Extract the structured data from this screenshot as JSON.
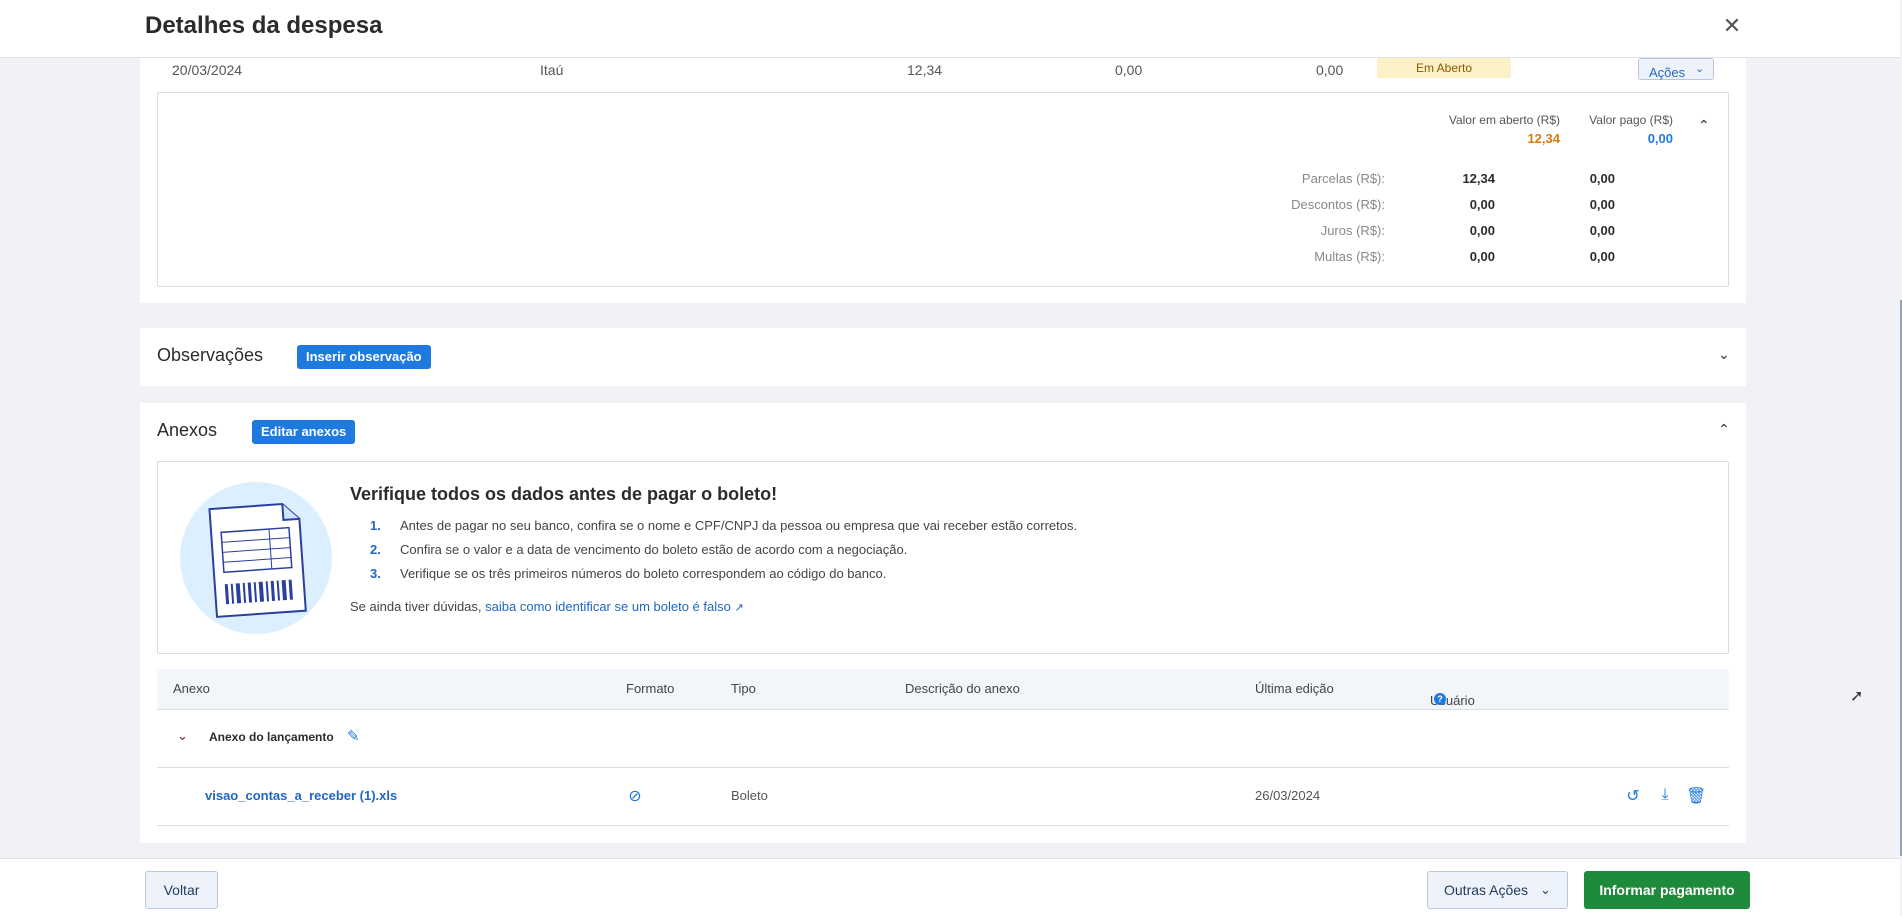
{
  "header": {
    "title": "Detalhes da despesa",
    "close_icon": "close-icon"
  },
  "installment": {
    "date": "20/03/2024",
    "bank": "Itaú",
    "value": "12,34",
    "v2": "0,00",
    "v3": "0,00",
    "status": "Em Aberto",
    "actions_label": "Ações"
  },
  "summary": {
    "open_label": "Valor em aberto (R$)",
    "paid_label": "Valor pago (R$)",
    "open_value": "12,34",
    "paid_value": "0,00",
    "open_color": "#d97a0f",
    "paid_color": "#1f7ae0",
    "rows": [
      {
        "label": "Parcelas (R$):",
        "open": "12,34",
        "paid": "0,00"
      },
      {
        "label": "Descontos (R$):",
        "open": "0,00",
        "paid": "0,00"
      },
      {
        "label": "Juros (R$):",
        "open": "0,00",
        "paid": "0,00"
      },
      {
        "label": "Multas (R$):",
        "open": "0,00",
        "paid": "0,00"
      }
    ]
  },
  "observations": {
    "title": "Observações",
    "button": "Inserir observação"
  },
  "attachments": {
    "title": "Anexos",
    "button": "Editar anexos",
    "warning": {
      "title": "Verifique todos os dados antes de pagar o boleto!",
      "items": [
        {
          "num": "1.",
          "text": "Antes de pagar no seu banco, confira se o nome e CPF/CNPJ da pessoa ou empresa que vai receber estão corretos."
        },
        {
          "num": "2.",
          "text": "Confira se o valor e a data de vencimento do boleto estão de acordo com a negociação."
        },
        {
          "num": "3.",
          "text": "Verifique se os três primeiros números do boleto correspondem ao código do banco."
        }
      ],
      "foot_text": "Se ainda tiver dúvidas,",
      "foot_link": "saiba como identificar se um boleto é falso"
    },
    "columns": [
      "Anexo",
      "Formato",
      "Tipo",
      "Descrição do anexo",
      "Última edição",
      "Usuário"
    ],
    "group_label": "Anexo do lançamento",
    "file": {
      "name": "visao_contas_a_receber (1).xls",
      "type": "Boleto",
      "date": "26/03/2024"
    }
  },
  "footer": {
    "back": "Voltar",
    "other": "Outras Ações",
    "pay": "Informar pagamento",
    "pay_color": "#1e8a3c"
  }
}
